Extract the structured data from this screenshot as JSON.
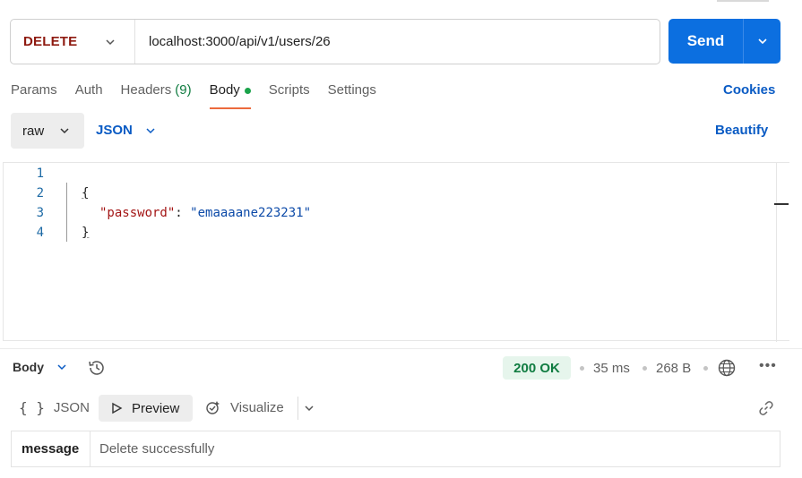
{
  "request": {
    "method": "DELETE",
    "url": "localhost:3000/api/v1/users/26",
    "send_label": "Send"
  },
  "tabs": [
    {
      "label": "Params"
    },
    {
      "label": "Auth"
    },
    {
      "label": "Headers",
      "count": "(9)"
    },
    {
      "label": "Body",
      "active": true
    },
    {
      "label": "Scripts"
    },
    {
      "label": "Settings"
    }
  ],
  "cookies_label": "Cookies",
  "body_options": {
    "mode": "raw",
    "language": "JSON",
    "beautify_label": "Beautify"
  },
  "editor": {
    "line_numbers": [
      "1",
      "2",
      "3",
      "4"
    ],
    "open_brace": "{",
    "key": "\"password\"",
    "colon": ": ",
    "value": "\"emaaaane223231\"",
    "close_brace": "}"
  },
  "response": {
    "section_label": "Body",
    "status": "200 OK",
    "time": "35 ms",
    "size": "268 B",
    "formats": {
      "json": "JSON",
      "preview": "Preview",
      "visualize": "Visualize"
    },
    "result": {
      "key": "message",
      "value": "Delete successfully"
    }
  },
  "colors": {
    "send": "#0c6fe0",
    "method": "#8e1a10",
    "status_bg": "#e6f5ec",
    "status_fg": "#107c41",
    "active_tab_underline": "#ec6a3c"
  }
}
